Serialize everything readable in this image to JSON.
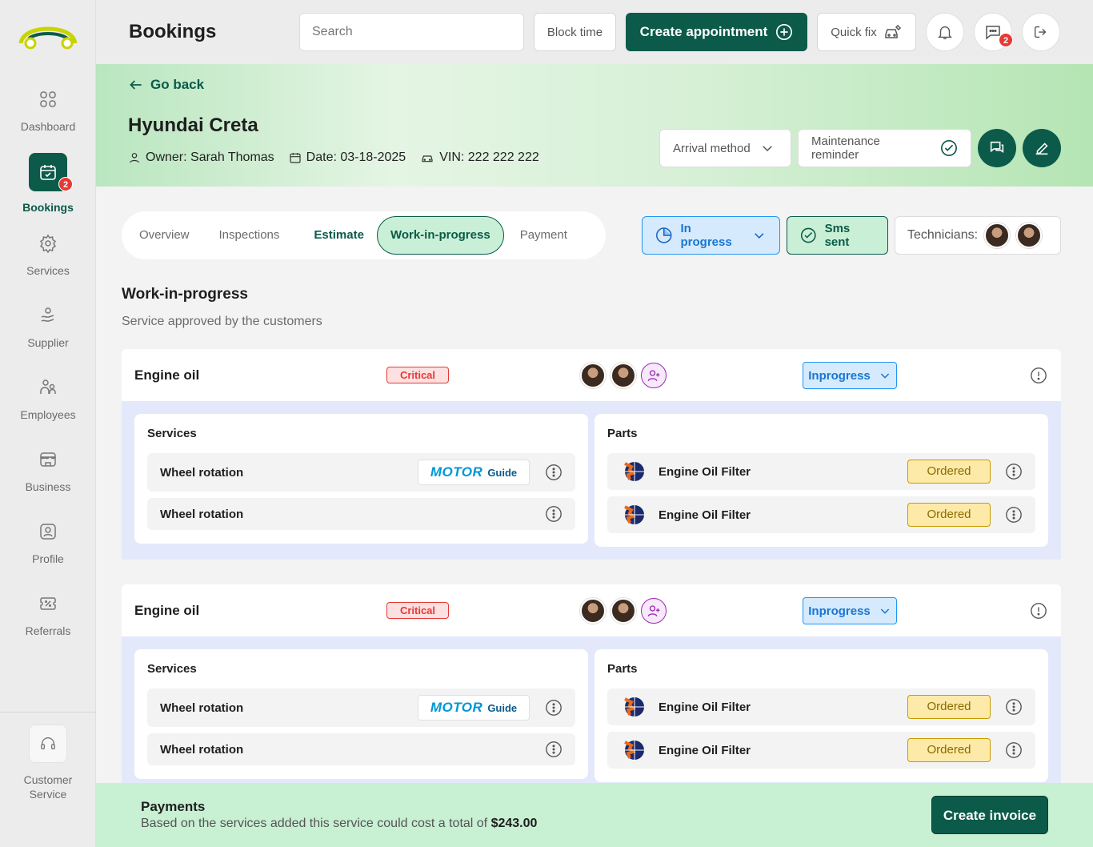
{
  "app": {
    "title": "Bookings"
  },
  "sidebar": {
    "items": [
      {
        "label": "Dashboard",
        "icon": "grid-icon"
      },
      {
        "label": "Bookings",
        "icon": "calendar-check-icon",
        "badge": "2",
        "active": true
      },
      {
        "label": "Services",
        "icon": "gear-icon"
      },
      {
        "label": "Supplier",
        "icon": "supplier-icon"
      },
      {
        "label": "Employees",
        "icon": "employees-icon"
      },
      {
        "label": "Business",
        "icon": "store-icon"
      },
      {
        "label": "Profile",
        "icon": "profile-icon"
      },
      {
        "label": "Referrals",
        "icon": "ticket-percent-icon"
      }
    ],
    "customer_service": "Customer Service"
  },
  "topbar": {
    "search_placeholder": "Search",
    "block_time": "Block time",
    "create_appointment": "Create appointment",
    "quick_fix": "Quick fix",
    "messages_badge": "2"
  },
  "hero": {
    "go_back": "Go back",
    "car": "Hyundai Creta",
    "owner": "Owner: Sarah Thomas",
    "date": "Date: 03-18-2025",
    "vin": "VIN: 222 222 222",
    "arrival_method": "Arrival method",
    "maintenance_reminder": "Maintenance reminder"
  },
  "tabs": [
    "Overview",
    "Inspections",
    "Estimate",
    "Work-in-progress",
    "Payment"
  ],
  "status": {
    "in_progress": "In progress",
    "sms_sent": "Sms sent",
    "technicians": "Technicians:"
  },
  "section": {
    "title": "Work-in-progress",
    "subtitle": "Service approved by the customers"
  },
  "cards": [
    {
      "name": "Engine oil",
      "priority": "Critical",
      "status": "Inprogress",
      "services_title": "Services",
      "services": [
        "Wheel rotation",
        "Wheel rotation"
      ],
      "parts_title": "Parts",
      "parts": [
        {
          "name": "Engine Oil Filter",
          "status": "Ordered"
        },
        {
          "name": "Engine Oil Filter",
          "status": "Ordered"
        }
      ]
    },
    {
      "name": "Engine oil",
      "priority": "Critical",
      "status": "Inprogress",
      "services_title": "Services",
      "services": [
        "Wheel rotation",
        "Wheel rotation"
      ],
      "parts_title": "Parts",
      "parts": [
        {
          "name": "Engine Oil Filter",
          "status": "Ordered"
        },
        {
          "name": "Engine Oil Filter",
          "status": "Ordered"
        }
      ]
    }
  ],
  "motor_guide": {
    "brand": "MOTOR",
    "label": "Guide"
  },
  "footer": {
    "title": "Payments",
    "desc": "Based on the services added this service could cost a total of ",
    "amount": "$243.00",
    "create_invoice": "Create invoice"
  },
  "colors": {
    "brand": "#0b5a4a",
    "critical": "#e53935",
    "inprogress": "#1976d2",
    "ordered": "#fdeaa8"
  }
}
